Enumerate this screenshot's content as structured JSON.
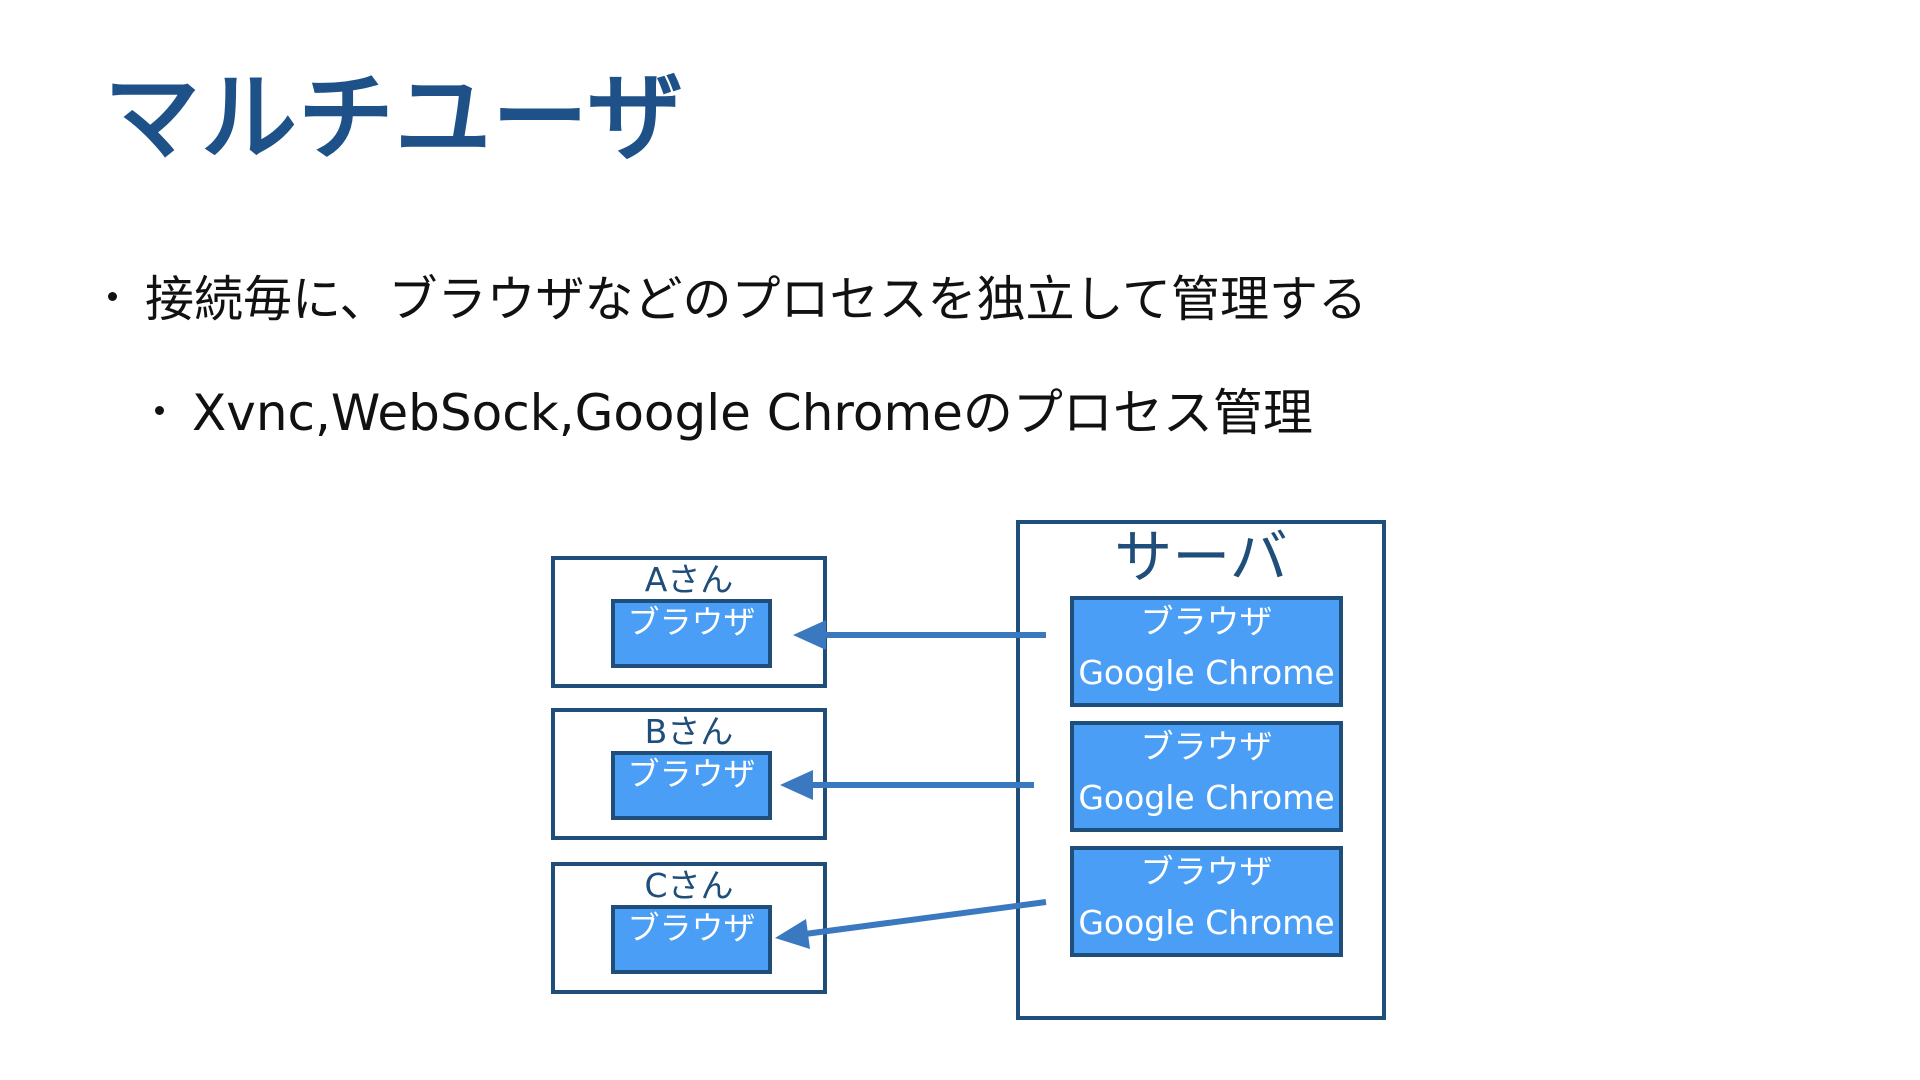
{
  "slide": {
    "title": "マルチユーザ",
    "bullets": [
      "接続毎に、ブラウザなどのプロセスを独立して管理する",
      "Xvnc,WebSock,Google Chromeのプロセス管理"
    ]
  },
  "diagram": {
    "clients": [
      {
        "label": "Aさん",
        "browser": "ブラウザ"
      },
      {
        "label": "Bさん",
        "browser": "ブラウザ"
      },
      {
        "label": "Cさん",
        "browser": "ブラウザ"
      }
    ],
    "server": {
      "label": "サーバ",
      "processes": [
        {
          "line1": "ブラウザ",
          "line2": "Google Chrome"
        },
        {
          "line1": "ブラウザ",
          "line2": "Google Chrome"
        },
        {
          "line1": "ブラウザ",
          "line2": "Google Chrome"
        }
      ]
    },
    "colors": {
      "border": "#1f4e7a",
      "fill": "#4a9ef5",
      "arrow": "#3a78c0",
      "title": "#1f5189"
    }
  }
}
